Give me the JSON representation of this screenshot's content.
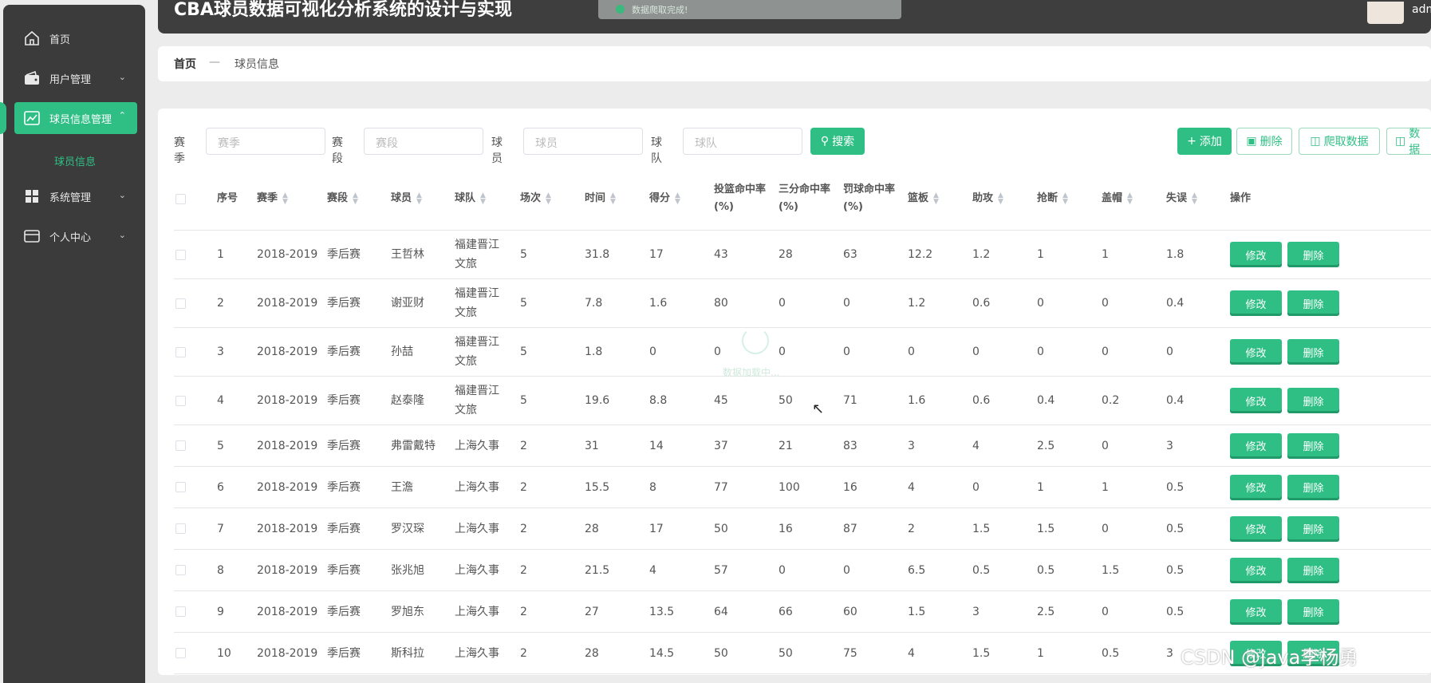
{
  "header": {
    "title": "CBA球员数据可视化分析系统的设计与实现",
    "toast": "数据爬取完成!",
    "user": "admin"
  },
  "sidebar": {
    "items": [
      {
        "label": "首页"
      },
      {
        "label": "用户管理"
      },
      {
        "label": "球员信息管理"
      },
      {
        "label": "系统管理"
      },
      {
        "label": "个人中心"
      }
    ],
    "sub_item": "球员信息"
  },
  "breadcrumb": {
    "home": "首页",
    "separator": "—",
    "current": "球员信息"
  },
  "filters": {
    "season_label": "赛季",
    "season_placeholder": "赛季",
    "stage_label": "赛段",
    "stage_placeholder": "赛段",
    "player_label": "球员",
    "player_placeholder": "球员",
    "team_label": "球队",
    "team_placeholder": "球队",
    "search_button": "搜索"
  },
  "toolbar": {
    "add": "添加",
    "delete": "删除",
    "crawl": "爬取数据",
    "data": "数据"
  },
  "table": {
    "columns": [
      "序号",
      "赛季",
      "赛段",
      "球员",
      "球队",
      "场次",
      "时间",
      "得分",
      "投篮命中率(%)",
      "三分命中率(%)",
      "罚球命中率(%)",
      "篮板",
      "助攻",
      "抢断",
      "盖帽",
      "失误",
      "操作"
    ],
    "edit_label": "修改",
    "delete_label": "删除",
    "rows": [
      [
        "1",
        "2018-2019",
        "季后赛",
        "王哲林",
        "福建晋江文旅",
        "5",
        "31.8",
        "17",
        "43",
        "28",
        "63",
        "12.2",
        "1.2",
        "1",
        "1",
        "1.8"
      ],
      [
        "2",
        "2018-2019",
        "季后赛",
        "谢亚财",
        "福建晋江文旅",
        "5",
        "7.8",
        "1.6",
        "80",
        "0",
        "0",
        "1.2",
        "0.6",
        "0",
        "0",
        "0.4"
      ],
      [
        "3",
        "2018-2019",
        "季后赛",
        "孙喆",
        "福建晋江文旅",
        "5",
        "1.8",
        "0",
        "0",
        "0",
        "0",
        "0",
        "0",
        "0",
        "0",
        "0"
      ],
      [
        "4",
        "2018-2019",
        "季后赛",
        "赵泰隆",
        "福建晋江文旅",
        "5",
        "19.6",
        "8.8",
        "45",
        "50",
        "71",
        "1.6",
        "0.6",
        "0.4",
        "0.2",
        "0.4"
      ],
      [
        "5",
        "2018-2019",
        "季后赛",
        "弗雷戴特",
        "上海久事",
        "2",
        "31",
        "14",
        "37",
        "21",
        "83",
        "3",
        "4",
        "2.5",
        "0",
        "3"
      ],
      [
        "6",
        "2018-2019",
        "季后赛",
        "王澹",
        "上海久事",
        "2",
        "15.5",
        "8",
        "77",
        "100",
        "16",
        "4",
        "0",
        "1",
        "1",
        "0.5"
      ],
      [
        "7",
        "2018-2019",
        "季后赛",
        "罗汉琛",
        "上海久事",
        "2",
        "28",
        "17",
        "50",
        "16",
        "87",
        "2",
        "1.5",
        "1.5",
        "0",
        "0.5"
      ],
      [
        "8",
        "2018-2019",
        "季后赛",
        "张兆旭",
        "上海久事",
        "2",
        "21.5",
        "4",
        "57",
        "0",
        "0",
        "6.5",
        "0.5",
        "0.5",
        "1.5",
        "0.5"
      ],
      [
        "9",
        "2018-2019",
        "季后赛",
        "罗旭东",
        "上海久事",
        "2",
        "27",
        "13.5",
        "64",
        "66",
        "60",
        "1.5",
        "3",
        "2.5",
        "0",
        "0.5"
      ],
      [
        "10",
        "2018-2019",
        "季后赛",
        "斯科拉",
        "上海久事",
        "2",
        "28",
        "14.5",
        "50",
        "50",
        "75",
        "4",
        "1.5",
        "1",
        "0.5",
        "3"
      ]
    ]
  },
  "loading_text": "数据加载中...",
  "watermark": "CSDN @java李杨勇"
}
